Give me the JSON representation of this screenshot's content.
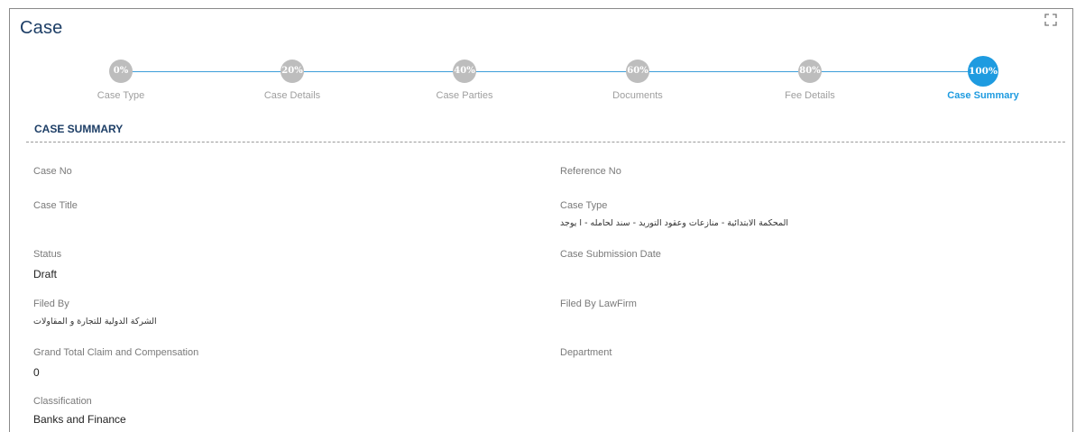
{
  "page": {
    "title": "Case",
    "expand_icon": "expand-icon"
  },
  "progress": {
    "accent_color": "#1e9be0",
    "inactive_color": "#bdbdbd",
    "steps": [
      {
        "percent": "0%",
        "label": "Case Type"
      },
      {
        "percent": "20%",
        "label": "Case Details"
      },
      {
        "percent": "40%",
        "label": "Case Parties"
      },
      {
        "percent": "60%",
        "label": "Documents"
      },
      {
        "percent": "80%",
        "label": "Fee Details"
      },
      {
        "percent": "100%",
        "label": "Case Summary",
        "active": true
      }
    ]
  },
  "summary": {
    "title": "CASE SUMMARY",
    "fields": {
      "case_no": {
        "label": "Case No",
        "value": ""
      },
      "reference_no": {
        "label": "Reference No",
        "value": ""
      },
      "case_title": {
        "label": "Case Title",
        "value": ""
      },
      "case_type": {
        "label": "Case Type",
        "value": "المحكمة الابتدائية - منازعات وعقود التوريد - سند لحامله - ا يوجد"
      },
      "status": {
        "label": "Status",
        "value": "Draft"
      },
      "submission_date": {
        "label": "Case Submission Date",
        "value": ""
      },
      "filed_by": {
        "label": "Filed By",
        "value": "الشركة الدولية للتجارة و المقاولات"
      },
      "filed_by_lawfirm": {
        "label": "Filed By LawFirm",
        "value": ""
      },
      "grand_total": {
        "label": "Grand Total Claim and Compensation",
        "value": "0"
      },
      "department": {
        "label": "Department",
        "value": ""
      },
      "classification": {
        "label": "Classification",
        "value": "Banks and Finance"
      }
    }
  }
}
